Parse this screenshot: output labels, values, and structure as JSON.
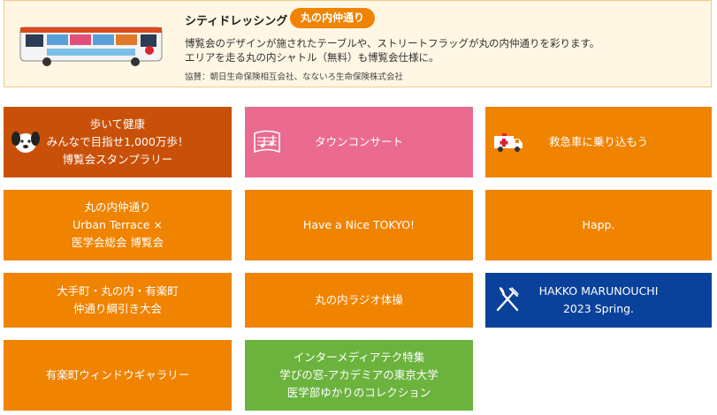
{
  "banner": {
    "title": "シティドレッシング",
    "tag": "丸の内仲通り",
    "desc_line1": "博覧会のデザインが施されたテーブルや、ストリートフラッグが丸の内仲通りを彩ります。",
    "desc_line2": "エリアを走る丸の内シャトル（無料）も博覧会仕様に。",
    "sponsor": "協賛：朝日生命保険相互会社、なないろ生命保険株式会社"
  },
  "tiles": [
    {
      "label": "歩いて健康\nみんなで目指せ1,000万歩！\n博覧会スタンプラリー",
      "icon": "dog-icon"
    },
    {
      "label": "タウンコンサート",
      "icon": "music-score-icon"
    },
    {
      "label": "救急車に乗り込もう",
      "icon": "ambulance-icon"
    },
    {
      "label": "丸の内仲通り\nUrban Terrace ×\n医学会総会 博覧会"
    },
    {
      "label": "Have a Nice TOKYO!"
    },
    {
      "label": "Happ."
    },
    {
      "label": "大手町・丸の内・有楽町\n仲通り綱引き大会"
    },
    {
      "label": "丸の内ラジオ体操"
    },
    {
      "label": "HAKKO MARUNOUCHI\n2023 Spring.",
      "icon": "fork-knife-icon"
    },
    {
      "label": "有楽町ウィンドウギャラリー"
    },
    {
      "label": "インターメディアテク特集\n学びの窓-アカデミアの東京大学\n医学部ゆかりのコレクション"
    }
  ],
  "colors": {
    "orange": "#f08300",
    "brown": "#c95008",
    "pink": "#ea6b8f",
    "navy": "#0a419b",
    "green": "#6cb33e"
  }
}
